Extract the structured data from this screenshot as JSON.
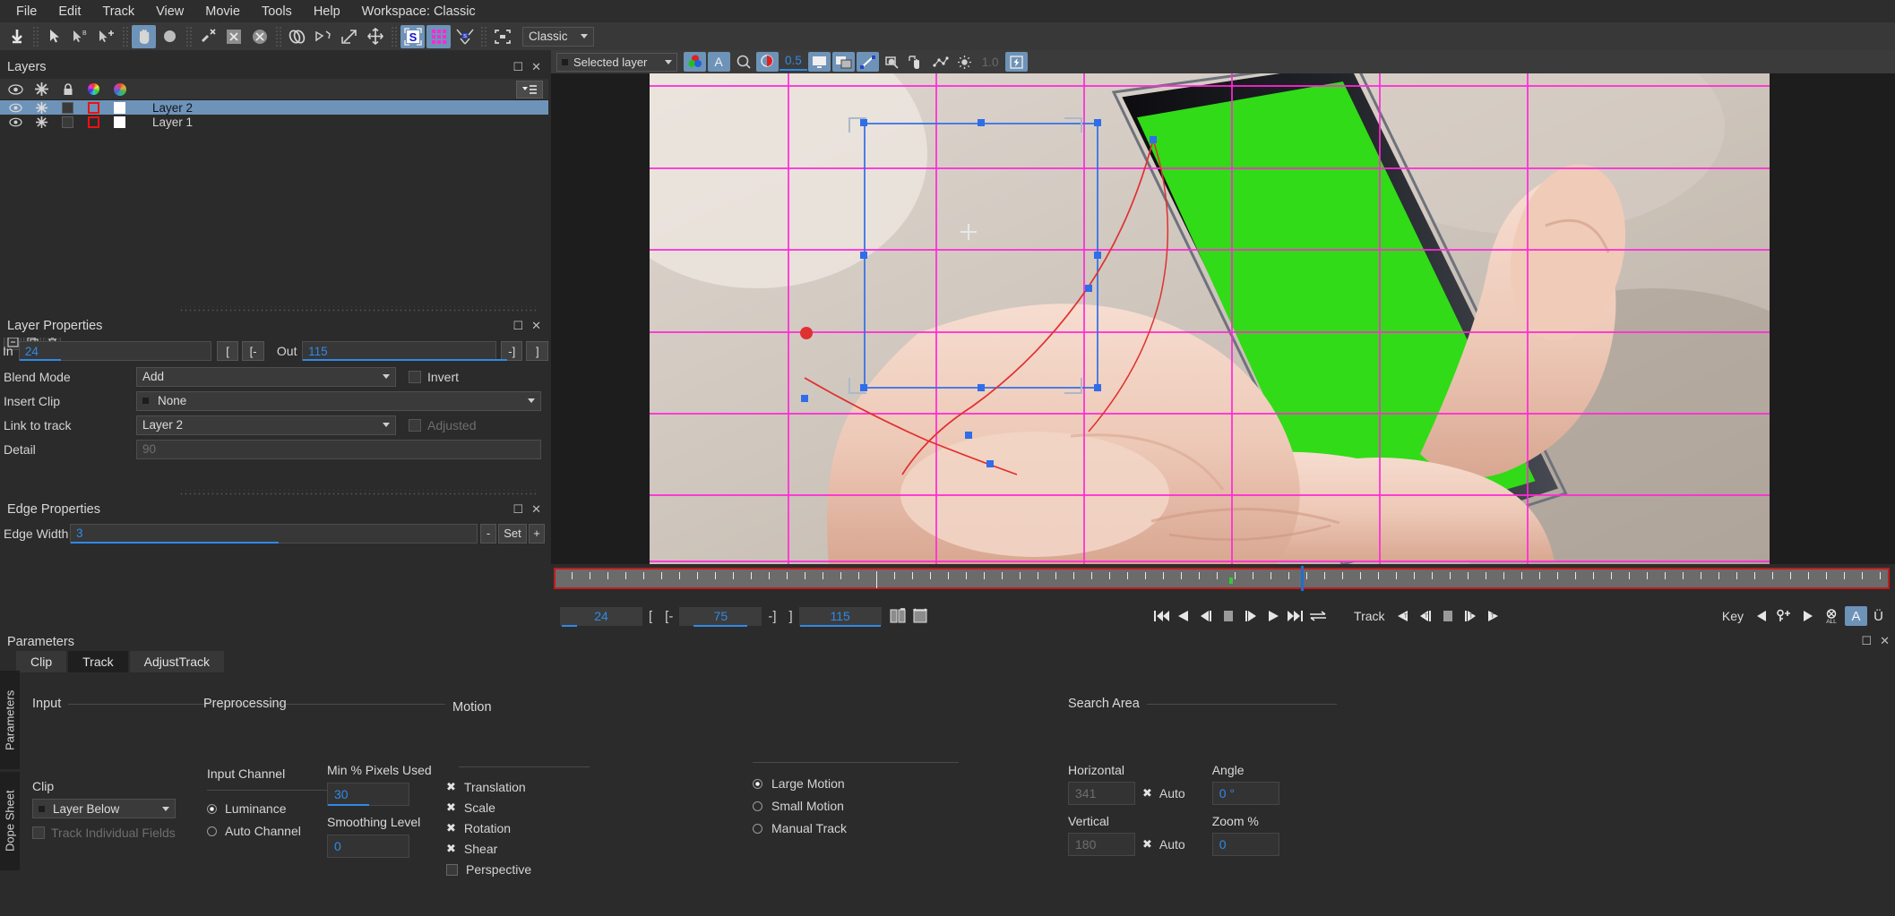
{
  "menubar": {
    "items": [
      "File",
      "Edit",
      "Track",
      "View",
      "Movie",
      "Tools",
      "Help"
    ],
    "workspace_label": "Workspace: Classic"
  },
  "toolbar": {
    "workspace_preset": "Classic",
    "tools": [
      {
        "name": "download-arrow-icon",
        "glyph": "⬇"
      },
      {
        "name": "select-arrow-icon",
        "glyph": "▲"
      },
      {
        "name": "select-b-icon",
        "glyph": "B"
      },
      {
        "name": "select-add-icon",
        "glyph": "+"
      },
      {
        "name": "pan-hand-icon",
        "glyph": "✋",
        "selected": true
      },
      {
        "name": "ellipse-icon",
        "glyph": "●"
      },
      {
        "name": "pin-remove-icon",
        "glyph": "x"
      },
      {
        "name": "box-x-icon",
        "glyph": "x"
      },
      {
        "name": "circle-x-icon",
        "glyph": "✖"
      },
      {
        "name": "link-chain-icon",
        "glyph": "⚭"
      },
      {
        "name": "shape-corner-icon",
        "glyph": "▷"
      },
      {
        "name": "transform-scale-icon",
        "glyph": "↗"
      },
      {
        "name": "move-icon",
        "glyph": "✥"
      },
      {
        "name": "surface-s-icon",
        "glyph": "S",
        "selected": true
      },
      {
        "name": "grid-warp-icon",
        "glyph": "▦",
        "selected": true
      },
      {
        "name": "corner-pin-icon",
        "glyph": "⤡"
      },
      {
        "name": "crop-region-icon",
        "glyph": "⬚"
      }
    ]
  },
  "subtoolbar": {
    "selected_layer_label": "Selected layer",
    "opacity_value": "0.5",
    "gamma_value": "1.0",
    "buttons": [
      {
        "name": "color-channels-icon",
        "on": true
      },
      {
        "name": "text-overlay-a-icon",
        "on": true
      },
      {
        "name": "matte-toggle-icon",
        "on": false
      },
      {
        "name": "overlay-red-icon",
        "on": true
      },
      {
        "name": "monitor-view-icon",
        "on": true
      },
      {
        "name": "dual-view-icon",
        "on": true
      },
      {
        "name": "motion-path-icon",
        "on": true
      },
      {
        "name": "magnifier-icon",
        "on": false
      },
      {
        "name": "hand-pan-icon",
        "on": false
      },
      {
        "name": "point-graph-icon",
        "on": false
      },
      {
        "name": "brightness-icon",
        "on": false
      },
      {
        "name": "lightning-icon",
        "on": true
      }
    ]
  },
  "layers_panel": {
    "title": "Layers",
    "column_icons": [
      "eye-icon",
      "gear-icon",
      "lock-icon",
      "color-wheel-icon",
      "color-swatch-icon"
    ],
    "rows": [
      {
        "name": "Layer 2",
        "selected": true
      },
      {
        "name": "Layer 1",
        "selected": false
      }
    ]
  },
  "layer_properties": {
    "title": "Layer Properties",
    "in_label": "In",
    "in_value": "24",
    "out_label": "Out",
    "out_value": "115",
    "bracket_buttons": [
      "[",
      "[-",
      "-]",
      "]"
    ],
    "blend_mode_label": "Blend Mode",
    "blend_mode_value": "Add",
    "invert_label": "Invert",
    "insert_clip_label": "Insert Clip",
    "insert_clip_value": "None",
    "link_to_track_label": "Link to track",
    "link_to_track_value": "Layer 2",
    "adjusted_label": "Adjusted",
    "detail_label": "Detail",
    "detail_value": "90"
  },
  "edge_properties": {
    "title": "Edge Properties",
    "edge_width_label": "Edge Width",
    "edge_width_value": "3",
    "minus_label": "-",
    "set_label": "Set",
    "plus_label": "+"
  },
  "timeline": {
    "current_frame": "24",
    "mid_frame": "75",
    "out_frame": "115",
    "brackets": [
      "[",
      "[-",
      "-]",
      "]"
    ],
    "track_label": "Track",
    "key_label": "Key",
    "all_label": "ALL",
    "a_label": "A",
    "u_label": "Ü"
  },
  "parameters": {
    "title": "Parameters",
    "side_tabs": [
      "Parameters",
      "Dope Sheet"
    ],
    "tabs": [
      {
        "label": "Clip",
        "active": false
      },
      {
        "label": "Track",
        "active": false
      },
      {
        "label": "AdjustTrack",
        "active": true
      }
    ],
    "sections": {
      "input": {
        "title": "Input",
        "clip_label": "Clip",
        "clip_value": "Layer Below",
        "track_individual_fields_label": "Track Individual Fields"
      },
      "preprocessing": {
        "title": "Preprocessing",
        "input_channel_label": "Input Channel",
        "channels": [
          {
            "label": "Luminance",
            "selected": true
          },
          {
            "label": "Auto Channel",
            "selected": false
          }
        ],
        "min_pct_pixels_label": "Min % Pixels Used",
        "min_pct_pixels_value": "30",
        "smoothing_level_label": "Smoothing Level",
        "smoothing_level_value": "0"
      },
      "motion": {
        "title": "Motion",
        "transforms": [
          {
            "label": "Translation",
            "checked": true
          },
          {
            "label": "Scale",
            "checked": true
          },
          {
            "label": "Rotation",
            "checked": true
          },
          {
            "label": "Shear",
            "checked": true
          },
          {
            "label": "Perspective",
            "checked": false
          }
        ],
        "modes": [
          {
            "label": "Large Motion",
            "selected": true
          },
          {
            "label": "Small Motion",
            "selected": false
          },
          {
            "label": "Manual Track",
            "selected": false
          }
        ]
      },
      "search_area": {
        "title": "Search Area",
        "horizontal_label": "Horizontal",
        "horizontal_value": "341",
        "horizontal_auto_label": "Auto",
        "vertical_label": "Vertical",
        "vertical_value": "180",
        "vertical_auto_label": "Auto",
        "angle_label": "Angle",
        "angle_value": "0 °",
        "zoom_label": "Zoom %",
        "zoom_value": "0"
      }
    }
  },
  "colors": {
    "accent_blue": "#2f8ae8",
    "selection_blue": "#6e93b8",
    "magenta_grid": "#ff29d7",
    "red_border": "#c21b1b",
    "green_screen": "#2ed614"
  }
}
